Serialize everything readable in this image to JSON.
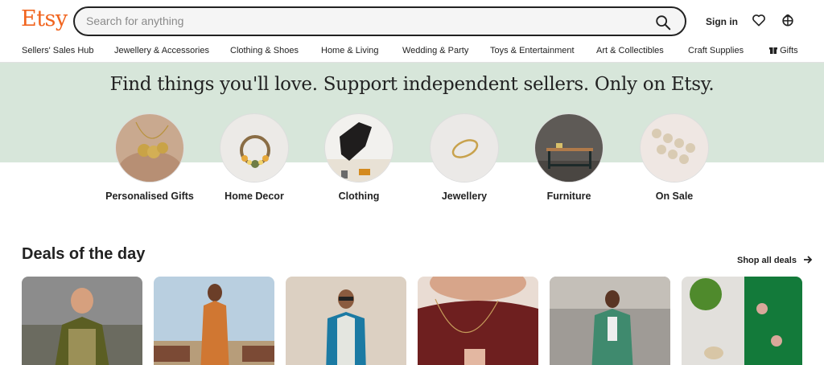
{
  "header": {
    "logo": "Etsy",
    "search_placeholder": "Search for anything",
    "sign_in": "Sign in"
  },
  "nav": {
    "items": [
      "Sellers' Sales Hub",
      "Jewellery & Accessories",
      "Clothing & Shoes",
      "Home & Living",
      "Wedding & Party",
      "Toys & Entertainment",
      "Art & Collectibles",
      "Craft Supplies",
      "Gifts"
    ]
  },
  "hero": {
    "title": "Find things you'll love. Support independent sellers. Only on Etsy."
  },
  "categories": [
    {
      "label": "Personalised Gifts"
    },
    {
      "label": "Home Decor"
    },
    {
      "label": "Clothing"
    },
    {
      "label": "Jewellery"
    },
    {
      "label": "Furniture"
    },
    {
      "label": "On Sale"
    }
  ],
  "deals": {
    "title": "Deals of the day",
    "shop_all": "Shop all deals"
  },
  "colors": {
    "brand": "#f1641e",
    "hero_bg": "#d7e6da"
  }
}
